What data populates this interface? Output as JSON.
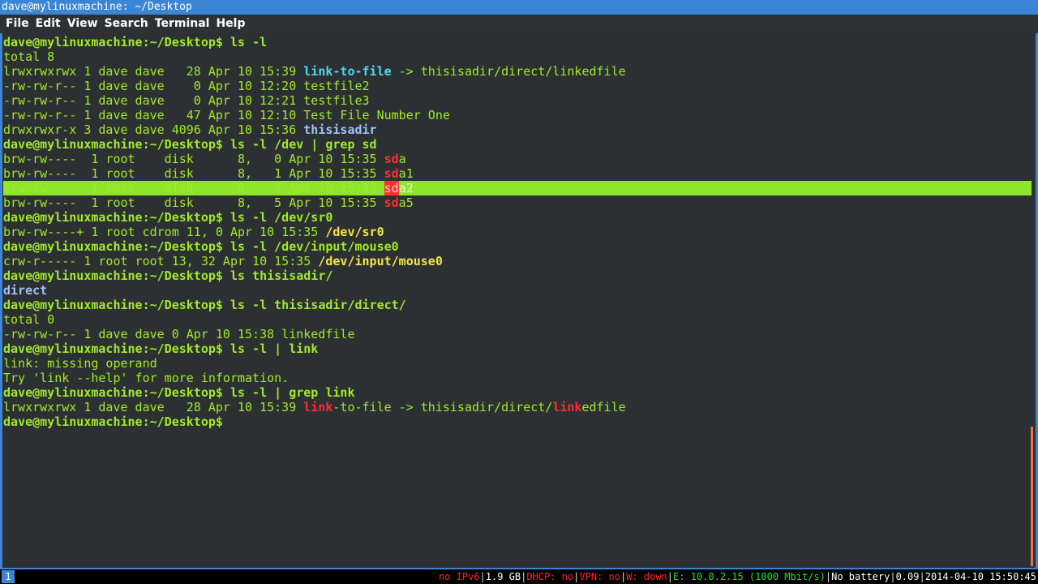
{
  "window": {
    "title": "dave@mylinuxmachine: ~/Desktop"
  },
  "menu": [
    "File",
    "Edit",
    "View",
    "Search",
    "Terminal",
    "Help"
  ],
  "colors": {
    "text": "#a0ea2a",
    "background": "#2d3033",
    "accent": "#3b85d4",
    "match": "#ff2d2d",
    "selection": "#8ee62a"
  },
  "terminal": {
    "lines": [
      {
        "segs": [
          [
            "dave@mylinuxmachine:~/Desktop$ ls -l",
            "b"
          ]
        ]
      },
      {
        "segs": [
          [
            "total 8",
            ""
          ]
        ]
      },
      {
        "segs": [
          [
            "lrwxrwxrwx 1 dave dave   28 Apr 10 15:39 ",
            ""
          ],
          [
            "link-to-file",
            "cyan"
          ],
          [
            " -> thisisadir/direct/linkedfile",
            ""
          ]
        ]
      },
      {
        "segs": [
          [
            "-rw-rw-r-- 1 dave dave    0 Apr 10 12:20 testfile2",
            ""
          ]
        ]
      },
      {
        "segs": [
          [
            "-rw-rw-r-- 1 dave dave    0 Apr 10 12:21 testfile3",
            ""
          ]
        ]
      },
      {
        "segs": [
          [
            "-rw-rw-r-- 1 dave dave   47 Apr 10 12:10 Test File Number One",
            ""
          ]
        ]
      },
      {
        "segs": [
          [
            "drwxrwxr-x 3 dave dave 4096 Apr 10 15:36 ",
            ""
          ],
          [
            "thisisadir",
            "blue"
          ]
        ]
      },
      {
        "segs": [
          [
            "dave@mylinuxmachine:~/Desktop$ ls -l /dev | grep sd",
            "b"
          ]
        ]
      },
      {
        "segs": [
          [
            "brw-rw----  1 root    disk      8,   0 Apr 10 15:35 ",
            ""
          ],
          [
            "sd",
            "red"
          ],
          [
            "a",
            ""
          ]
        ]
      },
      {
        "segs": [
          [
            "brw-rw----  1 root    disk      8,   1 Apr 10 15:35 ",
            ""
          ],
          [
            "sd",
            "red"
          ],
          [
            "a1",
            ""
          ]
        ]
      },
      {
        "hl": true,
        "segs": [
          [
            "brw-rw----  1 root    disk      8,   2 Apr 10 15:35 ",
            "hlbase"
          ],
          [
            "sd",
            "redbg"
          ],
          [
            "a2",
            "hlt"
          ]
        ]
      },
      {
        "segs": [
          [
            "brw-rw----  1 root    disk      8,   5 Apr 10 15:35 ",
            ""
          ],
          [
            "sd",
            "red"
          ],
          [
            "a5",
            ""
          ]
        ]
      },
      {
        "segs": [
          [
            "dave@mylinuxmachine:~/Desktop$ ls -l /dev/sr0",
            "b"
          ]
        ]
      },
      {
        "segs": [
          [
            "brw-rw----+ 1 root cdrom 11, 0 Apr 10 15:35 ",
            ""
          ],
          [
            "/dev/sr0",
            "yellow"
          ]
        ]
      },
      {
        "segs": [
          [
            "dave@mylinuxmachine:~/Desktop$ ls -l /dev/input/mouse0",
            "b"
          ]
        ]
      },
      {
        "segs": [
          [
            "crw-r----- 1 root root 13, 32 Apr 10 15:35 ",
            ""
          ],
          [
            "/dev/input/mouse0",
            "yellow"
          ]
        ]
      },
      {
        "segs": [
          [
            "dave@mylinuxmachine:~/Desktop$ ls thisisadir/",
            "b"
          ]
        ]
      },
      {
        "segs": [
          [
            "direct",
            "blue"
          ]
        ]
      },
      {
        "segs": [
          [
            "dave@mylinuxmachine:~/Desktop$ ls -l thisisadir/direct/",
            "b"
          ]
        ]
      },
      {
        "segs": [
          [
            "total 0",
            ""
          ]
        ]
      },
      {
        "segs": [
          [
            "-rw-rw-r-- 1 dave dave 0 Apr 10 15:38 linkedfile",
            ""
          ]
        ]
      },
      {
        "segs": [
          [
            "dave@mylinuxmachine:~/Desktop$ ls -l | link",
            "b"
          ]
        ]
      },
      {
        "segs": [
          [
            "link: missing operand",
            ""
          ]
        ]
      },
      {
        "segs": [
          [
            "Try 'link --help' for more information.",
            ""
          ]
        ]
      },
      {
        "segs": [
          [
            "dave@mylinuxmachine:~/Desktop$ ls -l | grep link",
            "b"
          ]
        ]
      },
      {
        "segs": [
          [
            "lrwxrwxrwx 1 dave dave   28 Apr 10 15:39 ",
            ""
          ],
          [
            "link",
            "red"
          ],
          [
            "-to-file -> thisisadir/direct/",
            ""
          ],
          [
            "link",
            "red"
          ],
          [
            "edfile",
            ""
          ]
        ]
      },
      {
        "segs": [
          [
            "dave@mylinuxmachine:~/Desktop$ ",
            "b"
          ]
        ]
      }
    ]
  },
  "statusbar": {
    "workspace": "1",
    "items": [
      [
        "no IPv6",
        "sr"
      ],
      [
        "1.9 GB",
        "sw"
      ],
      [
        "DHCP: no",
        "sr"
      ],
      [
        "VPN: no",
        "sr"
      ],
      [
        "W: down",
        "sr"
      ],
      [
        "E: 10.0.2.15 (1000 Mbit/s)",
        "sg"
      ],
      [
        "No battery",
        "sw"
      ],
      [
        "0.09",
        "sw"
      ],
      [
        "2014-04-10 15:50:45",
        "sw"
      ]
    ]
  }
}
